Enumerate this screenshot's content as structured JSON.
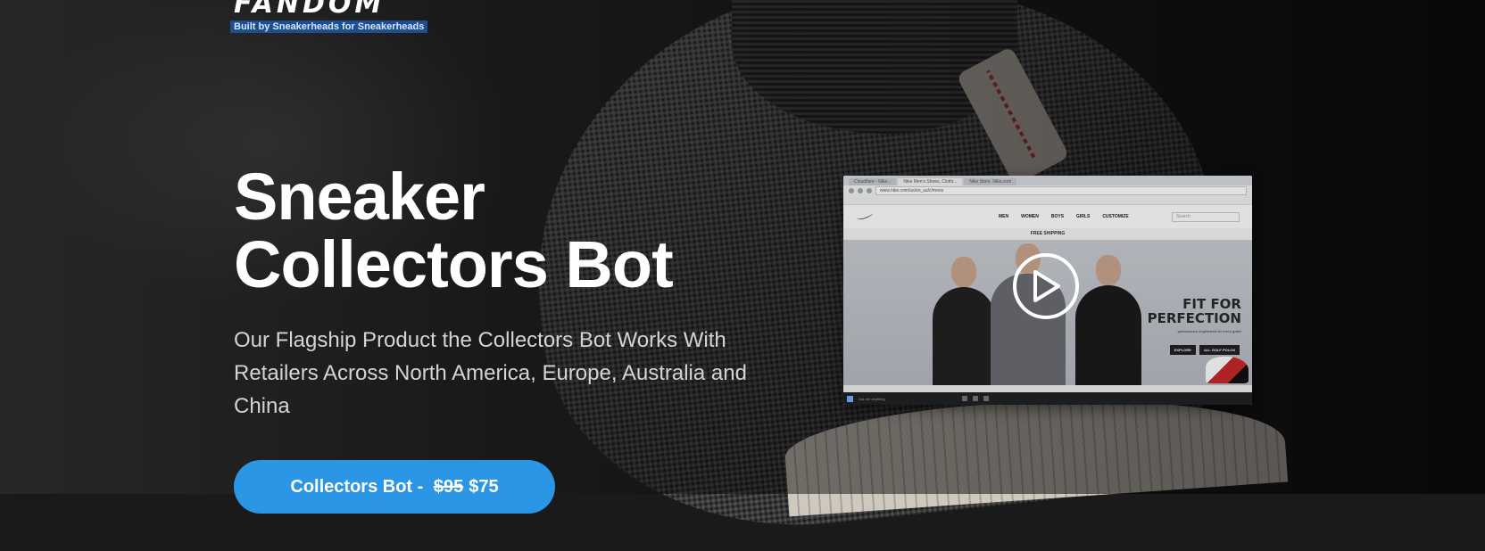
{
  "logo": {
    "wordmark": "FANDOM",
    "tagline": "Built by Sneakerheads for Sneakerheads"
  },
  "hero": {
    "title_line1": "Sneaker",
    "title_line2": "Collectors Bot",
    "subtitle": "Our Flagship Product the Collectors Bot Works With Retailers Across North America, Europe, Australia and China",
    "cta": {
      "label": "Collectors Bot -",
      "old_price": "$95",
      "new_price": "$75"
    }
  },
  "video_preview": {
    "browser_tabs": [
      "Cloudflare - Nike...",
      "Nike Men's Shoes, Clothi...",
      "Nike Store. Nike.com"
    ],
    "url": "www.nike.com/us/en_us/c/mens",
    "nav_links": [
      "MEN",
      "WOMEN",
      "BOYS",
      "GIRLS",
      "CUSTOMIZE"
    ],
    "search_placeholder": "Search",
    "promo_text": "FREE SHIPPING",
    "headline_line1": "FIT FOR",
    "headline_line2": "PERFECTION",
    "sub_copy": "performance engineered for every golfer",
    "actions": [
      "EXPLORE",
      "ALL GOLF POLOS"
    ],
    "taskbar_search": "Ask me anything"
  },
  "colors": {
    "accent": "#2b95e6",
    "tagline_bg": "#1d4f8f"
  },
  "icons": {
    "play": "play-icon",
    "swoosh": "swoosh-icon"
  }
}
